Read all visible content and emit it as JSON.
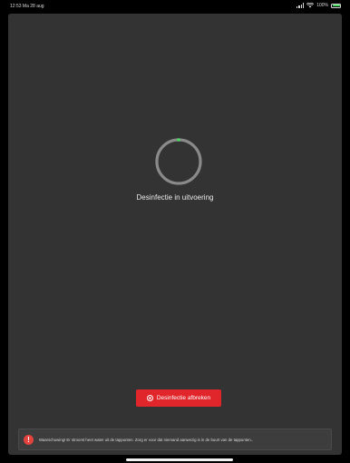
{
  "status_bar": {
    "time": "12:53",
    "date": "Ma 28 aug",
    "battery": "100%",
    "battery_color": "#4cd964"
  },
  "progress": {
    "label": "Desinfectie in uitvoering",
    "ring_color": "#8a8a8a",
    "indicator_color": "#4cd964"
  },
  "abort_button": {
    "label": "Desinfectie afbreken",
    "icon": "close-circle-icon",
    "color": "#e0262b"
  },
  "warning": {
    "icon": "warning-icon",
    "text": "Waarschuwing! Er stroomt heet water uit de tappunten. Zorg er voor dat niemand aanwezig is in de buurt van de tappunten..",
    "icon_color": "#e3433f"
  }
}
